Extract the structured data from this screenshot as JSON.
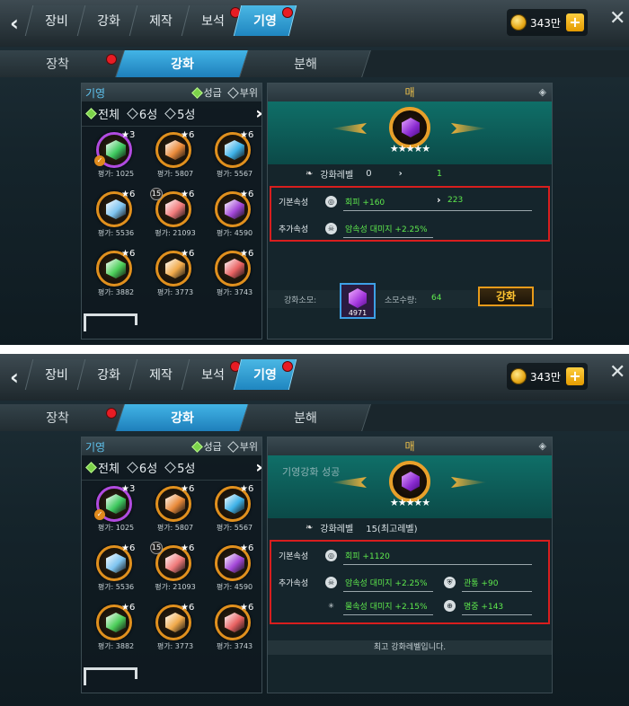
{
  "tabs": [
    "장비",
    "강화",
    "제작",
    "보석",
    "기영"
  ],
  "currency": "343만",
  "subtabs": [
    "장착",
    "강화",
    "분해"
  ],
  "list": {
    "category": "기영",
    "options": [
      "성급",
      "부위"
    ],
    "filters": [
      "전체",
      "6성",
      "5성"
    ]
  },
  "items": [
    {
      "rating": "평가: 1025",
      "stars": "★3",
      "gem": "#3ec95f"
    },
    {
      "rating": "평가: 5807",
      "stars": "★6",
      "gem": "#e98a3a"
    },
    {
      "rating": "평가: 5567",
      "stars": "★6",
      "gem": "#3fb2e8"
    },
    {
      "rating": "평가: 5536",
      "stars": "★6",
      "gem": "#7ec4f0"
    },
    {
      "rating": "평가: 21093",
      "stars": "★6",
      "gem": "#f07a7a",
      "level": "15"
    },
    {
      "rating": "평가: 4590",
      "stars": "★6",
      "gem": "#a347d8"
    },
    {
      "rating": "평가: 3882",
      "stars": "★6",
      "gem": "#4ccf5a"
    },
    {
      "rating": "평가: 3773",
      "stars": "★6",
      "gem": "#f0a94a"
    },
    {
      "rating": "평가: 3743",
      "stars": "★6",
      "gem": "#e86262"
    }
  ],
  "detail": {
    "title": "매",
    "stars_row": "★★★★★"
  },
  "panel1": {
    "level_label": "강화레벨",
    "level_from": "0",
    "level_to": "1",
    "base_label": "기본속성",
    "base_value": "회피 +160",
    "base_next": "223",
    "extra_label": "추가속성",
    "extra_value": "암속성 대미지 +2.25%",
    "cost_label": "강화소모:",
    "material_count": "4971",
    "qty_label": "소모수량:",
    "qty_value": "64",
    "enhance_button": "강화"
  },
  "panel2": {
    "success_text": "기영강화 성공",
    "level_label": "강화레벨",
    "level_value": "15(최고레벨)",
    "base_label": "기본속성",
    "base_value": "회피 +1120",
    "extra_label": "추가속성",
    "extras": [
      "암속성 대미지 +2.25%",
      "관통 +90",
      "물속성 대미지 +2.15%",
      "명중 +143"
    ],
    "max_text": "최고 강화레벨입니다."
  },
  "colors": {
    "accent": "#1f86c0",
    "highlight": "#d81e1e",
    "value_green": "#5ee94d",
    "gold": "#f0c24a"
  }
}
